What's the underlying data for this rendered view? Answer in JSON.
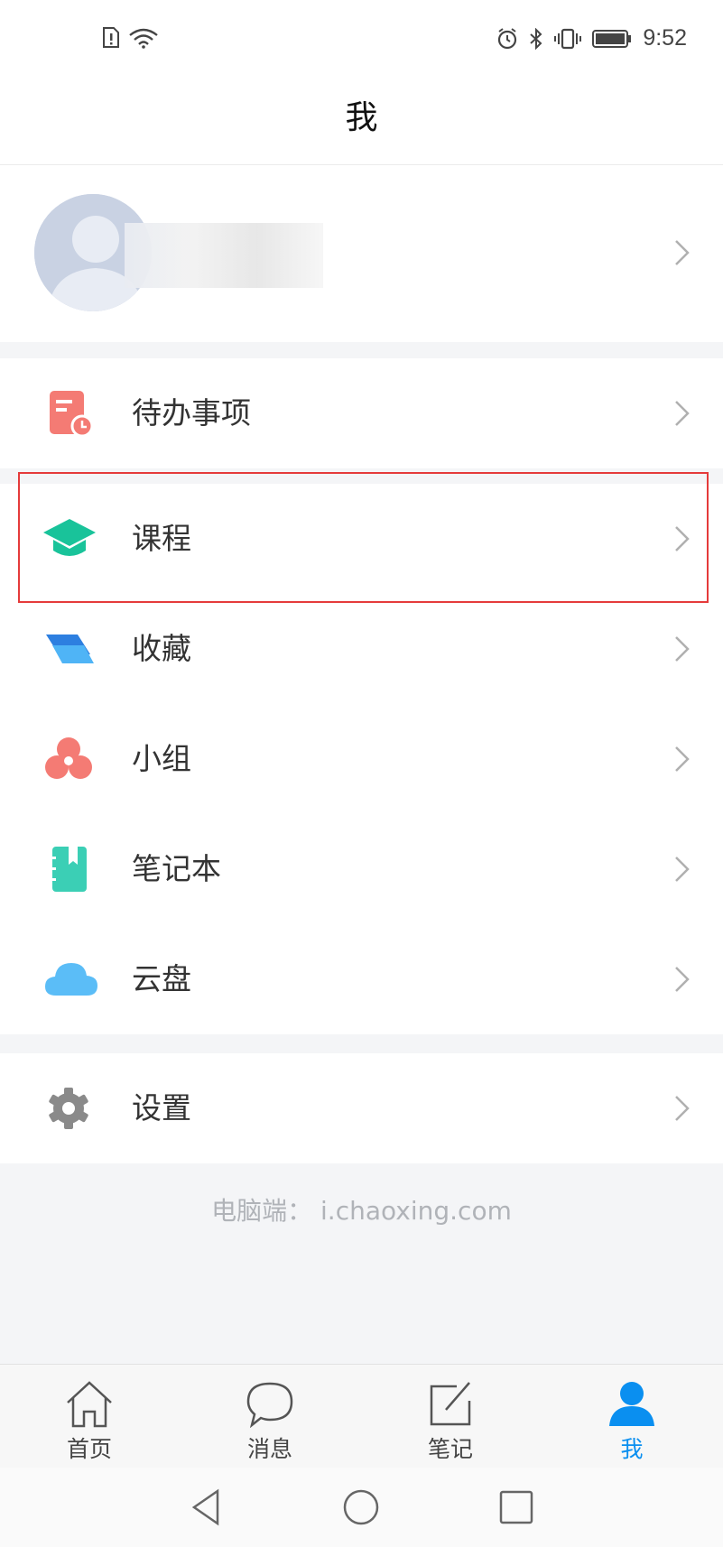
{
  "status_bar": {
    "time": "9:52"
  },
  "header": {
    "title": "我"
  },
  "profile": {
    "name": ""
  },
  "menu": {
    "todo": "待办事项",
    "course": "课程",
    "favorites": "收藏",
    "groups": "小组",
    "notebook": "笔记本",
    "cloud_disk": "云盘",
    "settings": "设置"
  },
  "footer": {
    "pc_text": "电脑端： i.chaoxing.com"
  },
  "tabs": [
    {
      "label": "首页"
    },
    {
      "label": "消息"
    },
    {
      "label": "笔记"
    },
    {
      "label": "我"
    }
  ],
  "colors": {
    "accent": "#0a8ff0",
    "highlight_border": "#e53b3b",
    "todo_icon": "#f47b74",
    "course_icon": "#19c39a",
    "favorites_icon": "#3ea7f5",
    "groups_icon": "#f47b74",
    "notebook_icon": "#3bcfb5",
    "cloud_icon": "#5bbdf7",
    "settings_icon": "#8a8a8a"
  },
  "icons": {
    "todo": "todo-list-icon",
    "course": "graduation-cap-icon",
    "favorites": "folder-stack-icon",
    "groups": "group-circles-icon",
    "notebook": "notebook-icon",
    "cloud_disk": "cloud-icon",
    "settings": "gear-icon"
  }
}
